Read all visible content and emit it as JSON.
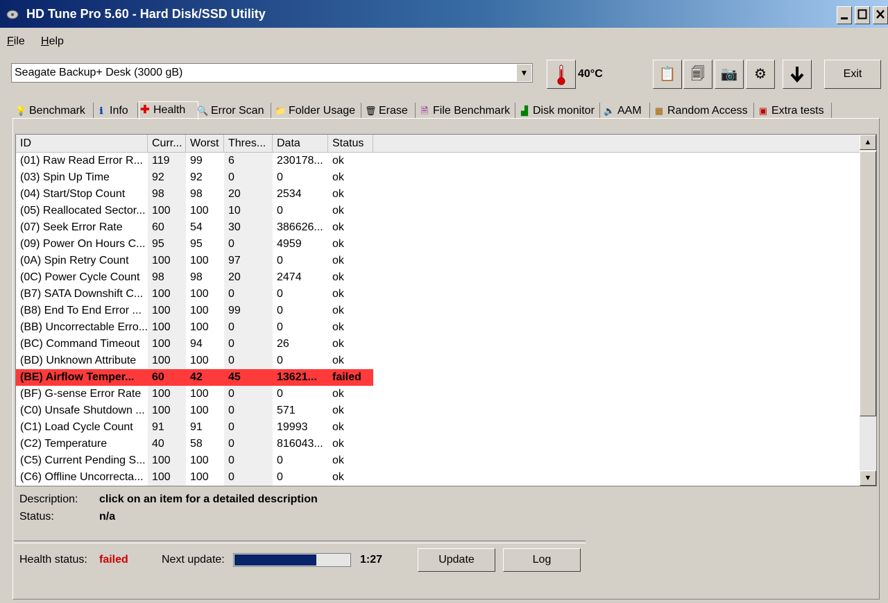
{
  "window": {
    "title": "HD Tune Pro 5.60 - Hard Disk/SSD Utility"
  },
  "menu": [
    {
      "label": "File",
      "accel": "F",
      "rest": "ile"
    },
    {
      "label": "Help",
      "accel": "H",
      "rest": "elp"
    }
  ],
  "toolbar": {
    "drive": "Seagate Backup+  Desk (3000 gB)",
    "temperature": "40",
    "temperature_unit": "°C",
    "exit_label": "Exit"
  },
  "tabs": [
    {
      "label": "Benchmark",
      "icon": "bulb-icon"
    },
    {
      "label": "Info",
      "icon": "info-icon"
    },
    {
      "label": "Health",
      "icon": "plus-icon"
    },
    {
      "label": "Error Scan",
      "icon": "magnifier-icon"
    },
    {
      "label": "Folder Usage",
      "icon": "folder-icon"
    },
    {
      "label": "Erase",
      "icon": "trash-icon"
    },
    {
      "label": "File Benchmark",
      "icon": "file-icon"
    },
    {
      "label": "Disk monitor",
      "icon": "chart-icon"
    },
    {
      "label": "AAM",
      "icon": "speaker-icon"
    },
    {
      "label": "Random Access",
      "icon": "grid-icon"
    },
    {
      "label": "Extra tests",
      "icon": "window-icon"
    }
  ],
  "active_tab": "Health",
  "table": {
    "columns": [
      "ID",
      "Curr...",
      "Worst",
      "Thres...",
      "Data",
      "Status"
    ],
    "rows": [
      [
        "(01) Raw Read Error R...",
        "119",
        "99",
        "6",
        "230178...",
        "ok"
      ],
      [
        "(03) Spin Up Time",
        "92",
        "92",
        "0",
        "0",
        "ok"
      ],
      [
        "(04) Start/Stop Count",
        "98",
        "98",
        "20",
        "2534",
        "ok"
      ],
      [
        "(05) Reallocated Sector...",
        "100",
        "100",
        "10",
        "0",
        "ok"
      ],
      [
        "(07) Seek Error Rate",
        "60",
        "54",
        "30",
        "386626...",
        "ok"
      ],
      [
        "(09) Power On Hours C...",
        "95",
        "95",
        "0",
        "4959",
        "ok"
      ],
      [
        "(0A) Spin Retry Count",
        "100",
        "100",
        "97",
        "0",
        "ok"
      ],
      [
        "(0C) Power Cycle Count",
        "98",
        "98",
        "20",
        "2474",
        "ok"
      ],
      [
        "(B7) SATA Downshift C...",
        "100",
        "100",
        "0",
        "0",
        "ok"
      ],
      [
        "(B8) End To End Error ...",
        "100",
        "100",
        "99",
        "0",
        "ok"
      ],
      [
        "(BB) Uncorrectable Erro...",
        "100",
        "100",
        "0",
        "0",
        "ok"
      ],
      [
        "(BC) Command Timeout",
        "100",
        "94",
        "0",
        "26",
        "ok"
      ],
      [
        "(BD) Unknown Attribute",
        "100",
        "100",
        "0",
        "0",
        "ok"
      ],
      [
        "(BE) Airflow Temper...",
        "60",
        "42",
        "45",
        "13621...",
        "failed"
      ],
      [
        "(BF) G-sense Error Rate",
        "100",
        "100",
        "0",
        "0",
        "ok"
      ],
      [
        "(C0) Unsafe Shutdown ...",
        "100",
        "100",
        "0",
        "571",
        "ok"
      ],
      [
        "(C1) Load Cycle Count",
        "91",
        "91",
        "0",
        "19993",
        "ok"
      ],
      [
        "(C2) Temperature",
        "40",
        "58",
        "0",
        "816043...",
        "ok"
      ],
      [
        "(C5) Current Pending S...",
        "100",
        "100",
        "0",
        "0",
        "ok"
      ],
      [
        "(C6) Offline Uncorrecta...",
        "100",
        "100",
        "0",
        "0",
        "ok"
      ]
    ]
  },
  "details": {
    "description_label": "Description:",
    "description_value": "click on an item for a detailed description",
    "status_label": "Status:",
    "status_value": "n/a"
  },
  "footer": {
    "health_label": "Health status:",
    "health_value": "failed",
    "next_update_label": "Next update:",
    "progress_fraction": 0.71,
    "time": "1:27",
    "update_label": "Update",
    "log_label": "Log"
  },
  "colors": {
    "failed_row": "#ff3a3a",
    "failed_text": "#cc0000",
    "progress": "#0a246a",
    "title_gradient_start": "#0a246a"
  }
}
